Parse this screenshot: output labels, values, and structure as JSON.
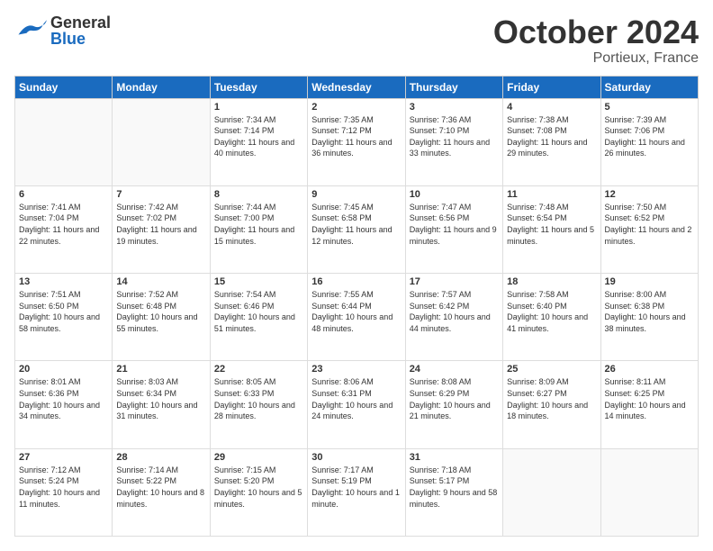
{
  "header": {
    "logo": {
      "general": "General",
      "blue": "Blue"
    },
    "title": "October 2024",
    "location": "Portieux, France"
  },
  "weekdays": [
    "Sunday",
    "Monday",
    "Tuesday",
    "Wednesday",
    "Thursday",
    "Friday",
    "Saturday"
  ],
  "weeks": [
    [
      {
        "day": "",
        "sunrise": "",
        "sunset": "",
        "daylight": ""
      },
      {
        "day": "",
        "sunrise": "",
        "sunset": "",
        "daylight": ""
      },
      {
        "day": "1",
        "sunrise": "Sunrise: 7:34 AM",
        "sunset": "Sunset: 7:14 PM",
        "daylight": "Daylight: 11 hours and 40 minutes."
      },
      {
        "day": "2",
        "sunrise": "Sunrise: 7:35 AM",
        "sunset": "Sunset: 7:12 PM",
        "daylight": "Daylight: 11 hours and 36 minutes."
      },
      {
        "day": "3",
        "sunrise": "Sunrise: 7:36 AM",
        "sunset": "Sunset: 7:10 PM",
        "daylight": "Daylight: 11 hours and 33 minutes."
      },
      {
        "day": "4",
        "sunrise": "Sunrise: 7:38 AM",
        "sunset": "Sunset: 7:08 PM",
        "daylight": "Daylight: 11 hours and 29 minutes."
      },
      {
        "day": "5",
        "sunrise": "Sunrise: 7:39 AM",
        "sunset": "Sunset: 7:06 PM",
        "daylight": "Daylight: 11 hours and 26 minutes."
      }
    ],
    [
      {
        "day": "6",
        "sunrise": "Sunrise: 7:41 AM",
        "sunset": "Sunset: 7:04 PM",
        "daylight": "Daylight: 11 hours and 22 minutes."
      },
      {
        "day": "7",
        "sunrise": "Sunrise: 7:42 AM",
        "sunset": "Sunset: 7:02 PM",
        "daylight": "Daylight: 11 hours and 19 minutes."
      },
      {
        "day": "8",
        "sunrise": "Sunrise: 7:44 AM",
        "sunset": "Sunset: 7:00 PM",
        "daylight": "Daylight: 11 hours and 15 minutes."
      },
      {
        "day": "9",
        "sunrise": "Sunrise: 7:45 AM",
        "sunset": "Sunset: 6:58 PM",
        "daylight": "Daylight: 11 hours and 12 minutes."
      },
      {
        "day": "10",
        "sunrise": "Sunrise: 7:47 AM",
        "sunset": "Sunset: 6:56 PM",
        "daylight": "Daylight: 11 hours and 9 minutes."
      },
      {
        "day": "11",
        "sunrise": "Sunrise: 7:48 AM",
        "sunset": "Sunset: 6:54 PM",
        "daylight": "Daylight: 11 hours and 5 minutes."
      },
      {
        "day": "12",
        "sunrise": "Sunrise: 7:50 AM",
        "sunset": "Sunset: 6:52 PM",
        "daylight": "Daylight: 11 hours and 2 minutes."
      }
    ],
    [
      {
        "day": "13",
        "sunrise": "Sunrise: 7:51 AM",
        "sunset": "Sunset: 6:50 PM",
        "daylight": "Daylight: 10 hours and 58 minutes."
      },
      {
        "day": "14",
        "sunrise": "Sunrise: 7:52 AM",
        "sunset": "Sunset: 6:48 PM",
        "daylight": "Daylight: 10 hours and 55 minutes."
      },
      {
        "day": "15",
        "sunrise": "Sunrise: 7:54 AM",
        "sunset": "Sunset: 6:46 PM",
        "daylight": "Daylight: 10 hours and 51 minutes."
      },
      {
        "day": "16",
        "sunrise": "Sunrise: 7:55 AM",
        "sunset": "Sunset: 6:44 PM",
        "daylight": "Daylight: 10 hours and 48 minutes."
      },
      {
        "day": "17",
        "sunrise": "Sunrise: 7:57 AM",
        "sunset": "Sunset: 6:42 PM",
        "daylight": "Daylight: 10 hours and 44 minutes."
      },
      {
        "day": "18",
        "sunrise": "Sunrise: 7:58 AM",
        "sunset": "Sunset: 6:40 PM",
        "daylight": "Daylight: 10 hours and 41 minutes."
      },
      {
        "day": "19",
        "sunrise": "Sunrise: 8:00 AM",
        "sunset": "Sunset: 6:38 PM",
        "daylight": "Daylight: 10 hours and 38 minutes."
      }
    ],
    [
      {
        "day": "20",
        "sunrise": "Sunrise: 8:01 AM",
        "sunset": "Sunset: 6:36 PM",
        "daylight": "Daylight: 10 hours and 34 minutes."
      },
      {
        "day": "21",
        "sunrise": "Sunrise: 8:03 AM",
        "sunset": "Sunset: 6:34 PM",
        "daylight": "Daylight: 10 hours and 31 minutes."
      },
      {
        "day": "22",
        "sunrise": "Sunrise: 8:05 AM",
        "sunset": "Sunset: 6:33 PM",
        "daylight": "Daylight: 10 hours and 28 minutes."
      },
      {
        "day": "23",
        "sunrise": "Sunrise: 8:06 AM",
        "sunset": "Sunset: 6:31 PM",
        "daylight": "Daylight: 10 hours and 24 minutes."
      },
      {
        "day": "24",
        "sunrise": "Sunrise: 8:08 AM",
        "sunset": "Sunset: 6:29 PM",
        "daylight": "Daylight: 10 hours and 21 minutes."
      },
      {
        "day": "25",
        "sunrise": "Sunrise: 8:09 AM",
        "sunset": "Sunset: 6:27 PM",
        "daylight": "Daylight: 10 hours and 18 minutes."
      },
      {
        "day": "26",
        "sunrise": "Sunrise: 8:11 AM",
        "sunset": "Sunset: 6:25 PM",
        "daylight": "Daylight: 10 hours and 14 minutes."
      }
    ],
    [
      {
        "day": "27",
        "sunrise": "Sunrise: 7:12 AM",
        "sunset": "Sunset: 5:24 PM",
        "daylight": "Daylight: 10 hours and 11 minutes."
      },
      {
        "day": "28",
        "sunrise": "Sunrise: 7:14 AM",
        "sunset": "Sunset: 5:22 PM",
        "daylight": "Daylight: 10 hours and 8 minutes."
      },
      {
        "day": "29",
        "sunrise": "Sunrise: 7:15 AM",
        "sunset": "Sunset: 5:20 PM",
        "daylight": "Daylight: 10 hours and 5 minutes."
      },
      {
        "day": "30",
        "sunrise": "Sunrise: 7:17 AM",
        "sunset": "Sunset: 5:19 PM",
        "daylight": "Daylight: 10 hours and 1 minute."
      },
      {
        "day": "31",
        "sunrise": "Sunrise: 7:18 AM",
        "sunset": "Sunset: 5:17 PM",
        "daylight": "Daylight: 9 hours and 58 minutes."
      },
      {
        "day": "",
        "sunrise": "",
        "sunset": "",
        "daylight": ""
      },
      {
        "day": "",
        "sunrise": "",
        "sunset": "",
        "daylight": ""
      }
    ]
  ]
}
